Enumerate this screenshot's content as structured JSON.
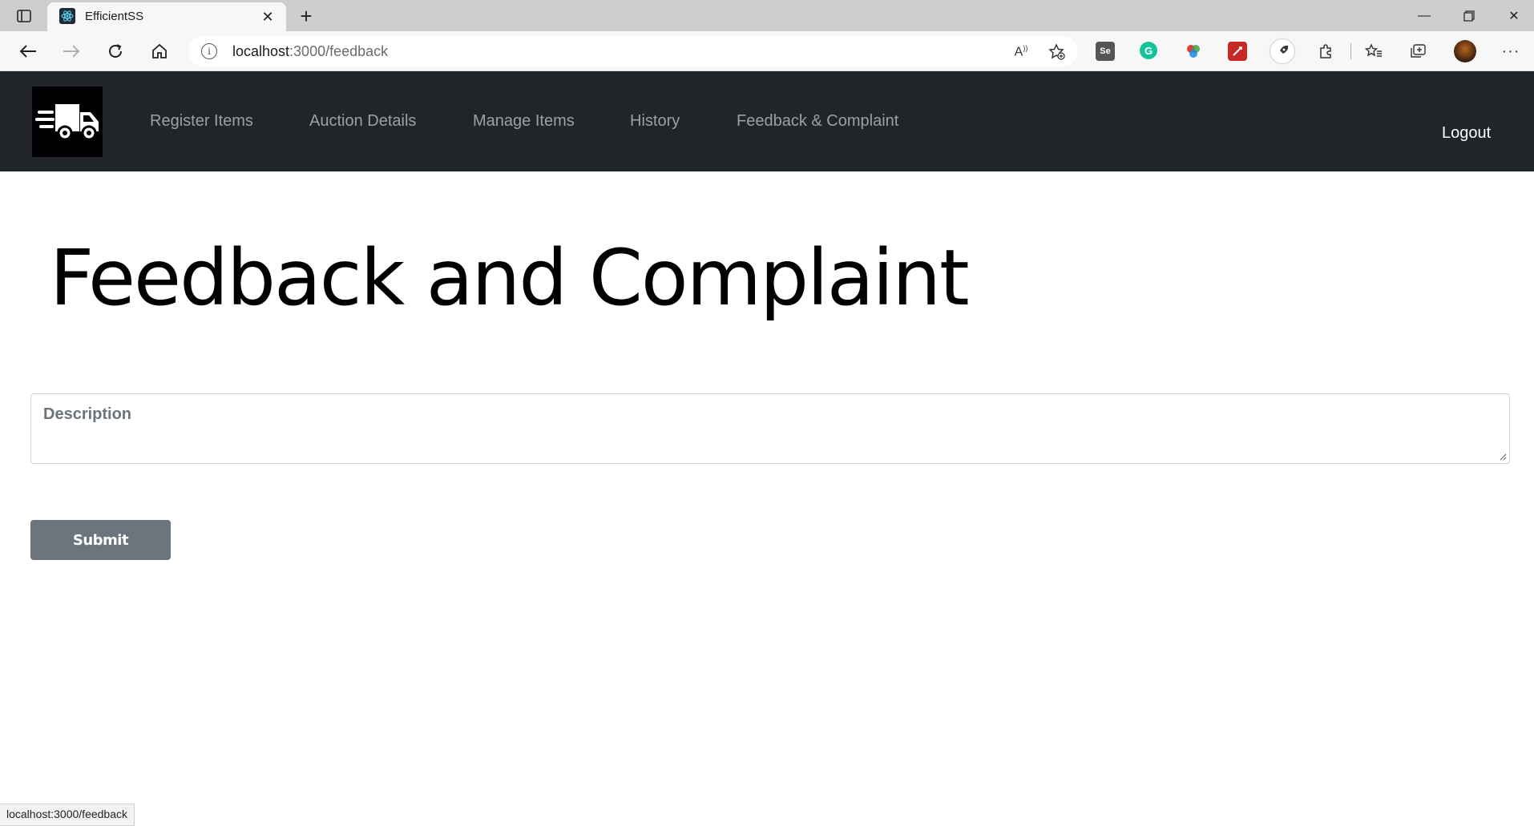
{
  "browser": {
    "tab_title": "EfficientSS",
    "address": {
      "host": "localhost",
      "path": ":3000/feedback"
    },
    "status_url": "localhost:3000/feedback"
  },
  "navbar": {
    "links": [
      {
        "label": "Register Items"
      },
      {
        "label": "Auction Details"
      },
      {
        "label": "Manage Items"
      },
      {
        "label": "History"
      },
      {
        "label": "Feedback & Complaint"
      }
    ],
    "logout_label": "Logout"
  },
  "page": {
    "title": "Feedback and Complaint",
    "description_label": "Description",
    "submit_label": "Submit"
  },
  "colors": {
    "navbar_bg": "#212529",
    "nav_link": "#9da0a3",
    "button_bg": "#6c757d"
  },
  "icons": [
    "sidebar-toggle-icon",
    "react-favicon-icon",
    "close-icon",
    "plus-icon",
    "back-arrow-icon",
    "forward-arrow-icon",
    "refresh-icon",
    "home-icon",
    "info-icon",
    "read-aloud-icon",
    "add-favorite-icon",
    "selenium-ext-icon",
    "grammarly-ext-icon",
    "color-ext-icon",
    "pdf-ext-icon",
    "rocket-ext-icon",
    "extensions-icon",
    "favorites-icon",
    "collections-icon",
    "profile-avatar",
    "more-icon",
    "truck-logo-icon"
  ]
}
